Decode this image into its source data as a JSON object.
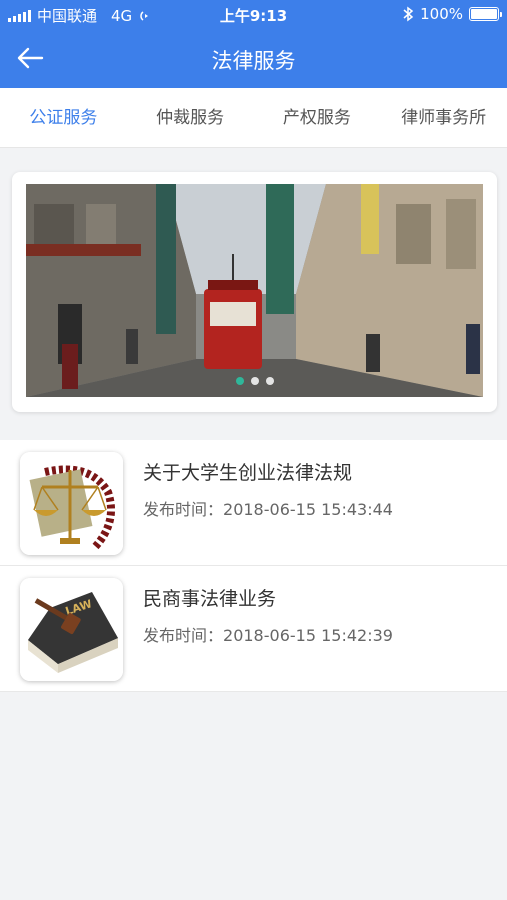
{
  "status_bar": {
    "carrier": "中国联通",
    "network": "4G",
    "time": "上午9:13",
    "battery_percent": "100%",
    "battery_level": 1.0
  },
  "nav": {
    "title": "法律服务",
    "back_icon": "arrow-left-icon"
  },
  "tabs": [
    {
      "label": "公证服务",
      "active": true
    },
    {
      "label": "仲裁服务",
      "active": false
    },
    {
      "label": "产权服务",
      "active": false
    },
    {
      "label": "律师事务所",
      "active": false
    }
  ],
  "banner": {
    "slide_count": 3,
    "active_index": 0
  },
  "articles": [
    {
      "title": "关于大学生创业法律法规",
      "date_label": "发布时间：",
      "date": "2018-06-15 15:43:44",
      "thumb_icon": "scales-of-justice-icon"
    },
    {
      "title": "民商事法律业务",
      "date_label": "发布时间：",
      "date": "2018-06-15 15:42:39",
      "thumb_icon": "law-book-gavel-icon"
    }
  ],
  "colors": {
    "primary": "#3d7fea",
    "dot_active": "#2fb79a",
    "background": "#f2f3f5"
  }
}
